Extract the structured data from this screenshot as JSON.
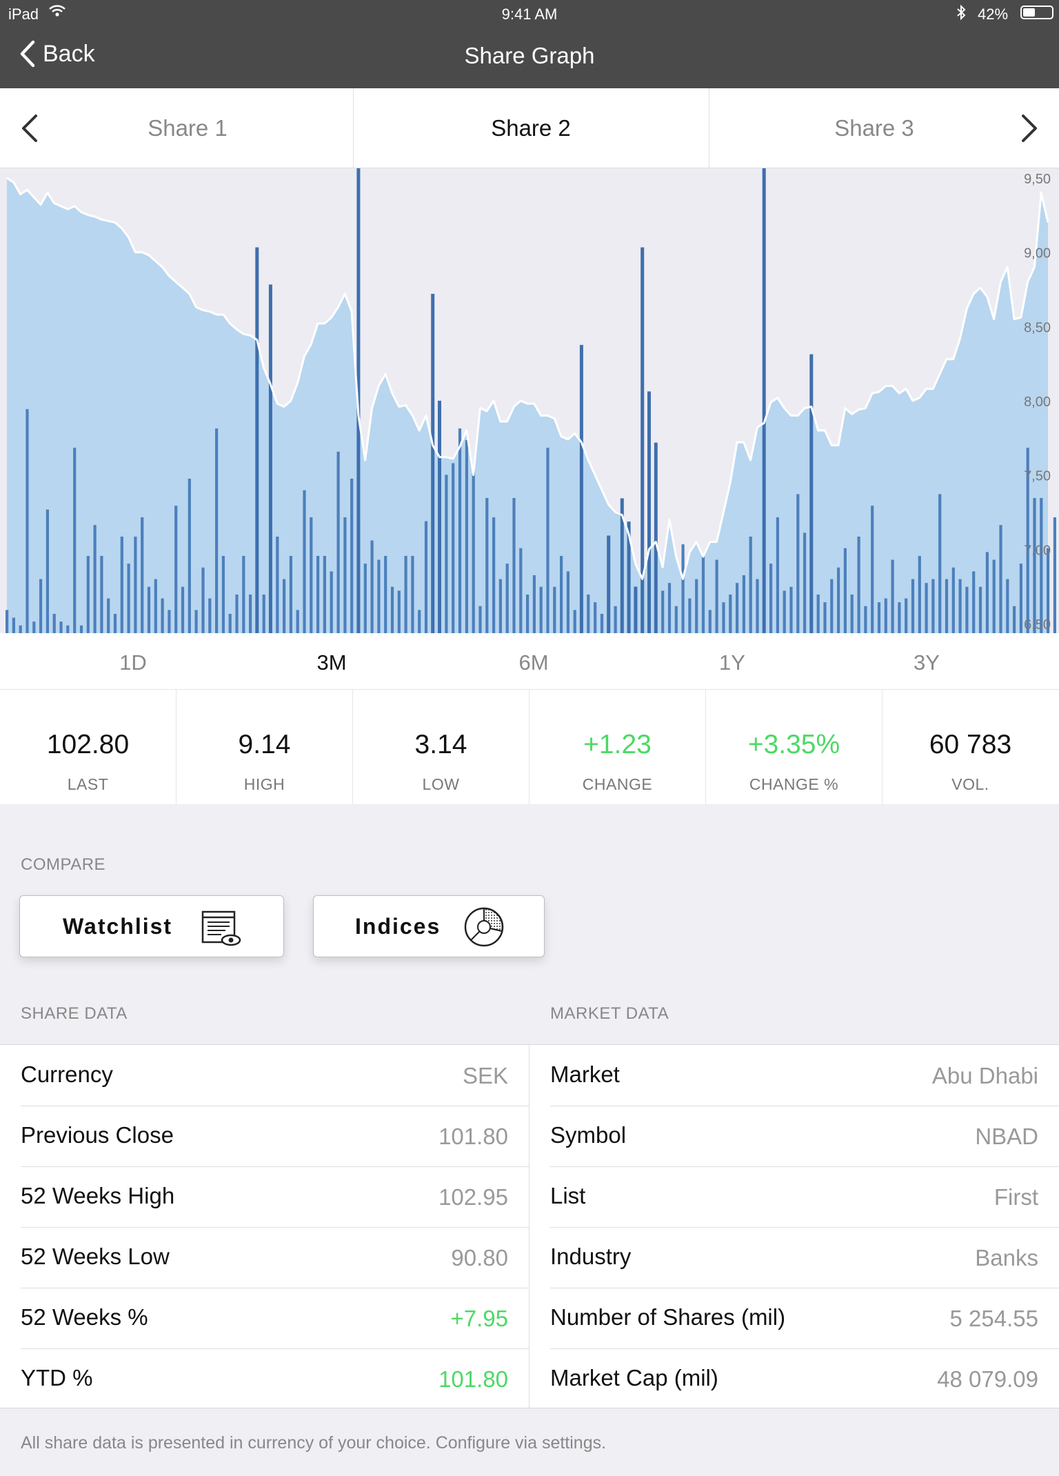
{
  "status_bar": {
    "device": "iPad",
    "time": "9:41 AM",
    "battery": "42%",
    "battery_level": 0.42
  },
  "nav": {
    "back_label": "Back",
    "title": "Share Graph"
  },
  "share_tabs": [
    {
      "label": "Share 1"
    },
    {
      "label": "Share 2",
      "active": true
    },
    {
      "label": "Share 3"
    }
  ],
  "ranges": [
    {
      "label": "1D"
    },
    {
      "label": "3M",
      "active": true
    },
    {
      "label": "6M"
    },
    {
      "label": "1Y"
    },
    {
      "label": "3Y"
    }
  ],
  "stats": [
    {
      "value": "102.80",
      "label": "LAST"
    },
    {
      "value": "9.14",
      "label": "HIGH"
    },
    {
      "value": "3.14",
      "label": "LOW"
    },
    {
      "value": "+1.23",
      "label": "CHANGE",
      "up": true
    },
    {
      "value": "+3.35%",
      "label": "CHANGE %",
      "up": true
    },
    {
      "value": "60 783",
      "label": "VOL."
    }
  ],
  "compare": {
    "label": "COMPARE",
    "watchlist": "Watchlist",
    "indices": "Indices"
  },
  "share_data": {
    "label": "SHARE DATA",
    "rows": [
      {
        "k": "Currency",
        "v": "SEK"
      },
      {
        "k": "Previous Close",
        "v": "101.80"
      },
      {
        "k": "52 Weeks High",
        "v": "102.95"
      },
      {
        "k": "52 Weeks Low",
        "v": "90.80"
      },
      {
        "k": "52 Weeks %",
        "v": "+7.95",
        "up": true
      },
      {
        "k": "YTD %",
        "v": "101.80",
        "up": true
      }
    ]
  },
  "market_data": {
    "label": "MARKET DATA",
    "rows": [
      {
        "k": "Market",
        "v": "Abu Dhabi"
      },
      {
        "k": "Symbol",
        "v": "NBAD"
      },
      {
        "k": "List",
        "v": "First"
      },
      {
        "k": "Industry",
        "v": "Banks"
      },
      {
        "k": "Number of Shares (mil)",
        "v": "5 254.55"
      },
      {
        "k": "Market Cap (mil)",
        "v": "48 079.09"
      }
    ]
  },
  "footer": "All share data is presented in currency of your choice. Configure via settings.",
  "colors": {
    "nav_bg": "#4a4a4a",
    "area_fill": "#b8d6ef",
    "volume_bar": "#4d7fbc",
    "price_line": "#ffffff",
    "positive": "#4cd964"
  },
  "chart_data": {
    "type": "area",
    "ytick_labels": [
      "9,50",
      "9,00",
      "8,50",
      "8,00",
      "7,50",
      "7,00",
      "6,50"
    ],
    "ylim": [
      6.5,
      9.5
    ],
    "price": [
      9.5,
      9.47,
      9.39,
      9.42,
      9.37,
      9.32,
      9.4,
      9.33,
      9.31,
      9.29,
      9.31,
      9.27,
      9.25,
      9.24,
      9.22,
      9.21,
      9.2,
      9.16,
      9.1,
      9.0,
      9.0,
      8.98,
      8.94,
      8.9,
      8.84,
      8.8,
      8.76,
      8.72,
      8.63,
      8.61,
      8.6,
      8.58,
      8.58,
      8.52,
      8.48,
      8.45,
      8.44,
      8.41,
      8.22,
      8.11,
      7.98,
      7.96,
      8.0,
      8.12,
      8.3,
      8.38,
      8.52,
      8.52,
      8.56,
      8.63,
      8.72,
      8.6,
      7.9,
      7.6,
      7.95,
      8.1,
      8.18,
      8.05,
      7.96,
      7.97,
      7.9,
      7.8,
      7.9,
      7.7,
      7.62,
      7.62,
      7.61,
      7.69,
      7.8,
      7.5,
      7.95,
      7.93,
      8.0,
      7.86,
      7.86,
      7.96,
      8.0,
      7.98,
      7.98,
      7.9,
      7.9,
      7.88,
      7.76,
      7.74,
      7.78,
      7.72,
      7.6,
      7.5,
      7.4,
      7.3,
      7.25,
      7.23,
      7.1,
      6.9,
      6.8,
      7.0,
      7.05,
      6.88,
      7.2,
      6.95,
      6.8,
      6.98,
      7.05,
      6.95,
      7.05,
      7.05,
      7.25,
      7.45,
      7.72,
      7.72,
      7.6,
      7.82,
      7.85,
      7.99,
      8.02,
      7.95,
      7.9,
      7.9,
      7.95,
      7.96,
      7.8,
      7.8,
      7.7,
      7.7,
      7.95,
      7.91,
      7.94,
      7.95,
      8.05,
      8.06,
      8.1,
      8.1,
      8.05,
      8.08,
      8.0,
      8.02,
      8.08,
      8.08,
      8.18,
      8.28,
      8.28,
      8.42,
      8.62,
      8.72,
      8.76,
      8.7,
      8.55,
      8.8,
      8.9,
      8.55,
      8.56,
      8.8,
      8.9,
      9.4,
      9.2
    ],
    "volume_rel": [
      0.06,
      0.04,
      0.02,
      0.58,
      0.03,
      0.14,
      0.32,
      0.05,
      0.03,
      0.02,
      0.48,
      0.02,
      0.2,
      0.28,
      0.2,
      0.09,
      0.05,
      0.25,
      0.18,
      0.25,
      0.3,
      0.12,
      0.14,
      0.09,
      0.06,
      0.33,
      0.12,
      0.4,
      0.06,
      0.17,
      0.09,
      0.53,
      0.2,
      0.05,
      0.1,
      0.2,
      0.1,
      0.08,
      0.1,
      0.05,
      0.25,
      0.14,
      0.2,
      0.06,
      0.37,
      0.3,
      0.2,
      0.2,
      0.16,
      0.47,
      0.3,
      0.4,
      0.3,
      0.18,
      0.24,
      0.19,
      0.2,
      0.12,
      0.11,
      0.2,
      0.2,
      0.06,
      0.29,
      0.31,
      0.4,
      0.41,
      0.44,
      0.53,
      0.5,
      0.43,
      0.07,
      0.35,
      0.3,
      0.14,
      0.18,
      0.35,
      0.22,
      0.1,
      0.15,
      0.12,
      0.48,
      0.12,
      0.2,
      0.16,
      0.06,
      0.01,
      0.1,
      0.08,
      0.05,
      0.06,
      0.07,
      0.18,
      0.22,
      0.1,
      0.09,
      0.29,
      0.06,
      0.11,
      0.13,
      0.07,
      0.23,
      0.09,
      0.14,
      0.2,
      0.06,
      0.19,
      0.08,
      0.1,
      0.13,
      0.15,
      0.25,
      0.14,
      0.1,
      0.18,
      0.3,
      0.11,
      0.12,
      0.36,
      0.26,
      0.2,
      0.1,
      0.08,
      0.14,
      0.17,
      0.22,
      0.1,
      0.25,
      0.07,
      0.33,
      0.08,
      0.09,
      0.19,
      0.08,
      0.09,
      0.14,
      0.2,
      0.13,
      0.14,
      0.36,
      0.14,
      0.17,
      0.14,
      0.12,
      0.16,
      0.12,
      0.21,
      0.19,
      0.28,
      0.14,
      0.07,
      0.18,
      0.48,
      0.35,
      0.35,
      0.22,
      0.3
    ],
    "volume_spike_rel": [
      {
        "i": 37,
        "v": 0.83
      },
      {
        "i": 39,
        "v": 0.75
      },
      {
        "i": 52,
        "v": 1.0
      },
      {
        "i": 63,
        "v": 0.73
      },
      {
        "i": 64,
        "v": 0.5
      },
      {
        "i": 85,
        "v": 0.62
      },
      {
        "i": 89,
        "v": 0.21
      },
      {
        "i": 91,
        "v": 0.29
      },
      {
        "i": 92,
        "v": 0.24
      },
      {
        "i": 93,
        "v": 0.1
      },
      {
        "i": 94,
        "v": 0.83
      },
      {
        "i": 95,
        "v": 0.52
      },
      {
        "i": 96,
        "v": 0.41
      },
      {
        "i": 112,
        "v": 1.0
      },
      {
        "i": 119,
        "v": 0.6
      }
    ]
  }
}
